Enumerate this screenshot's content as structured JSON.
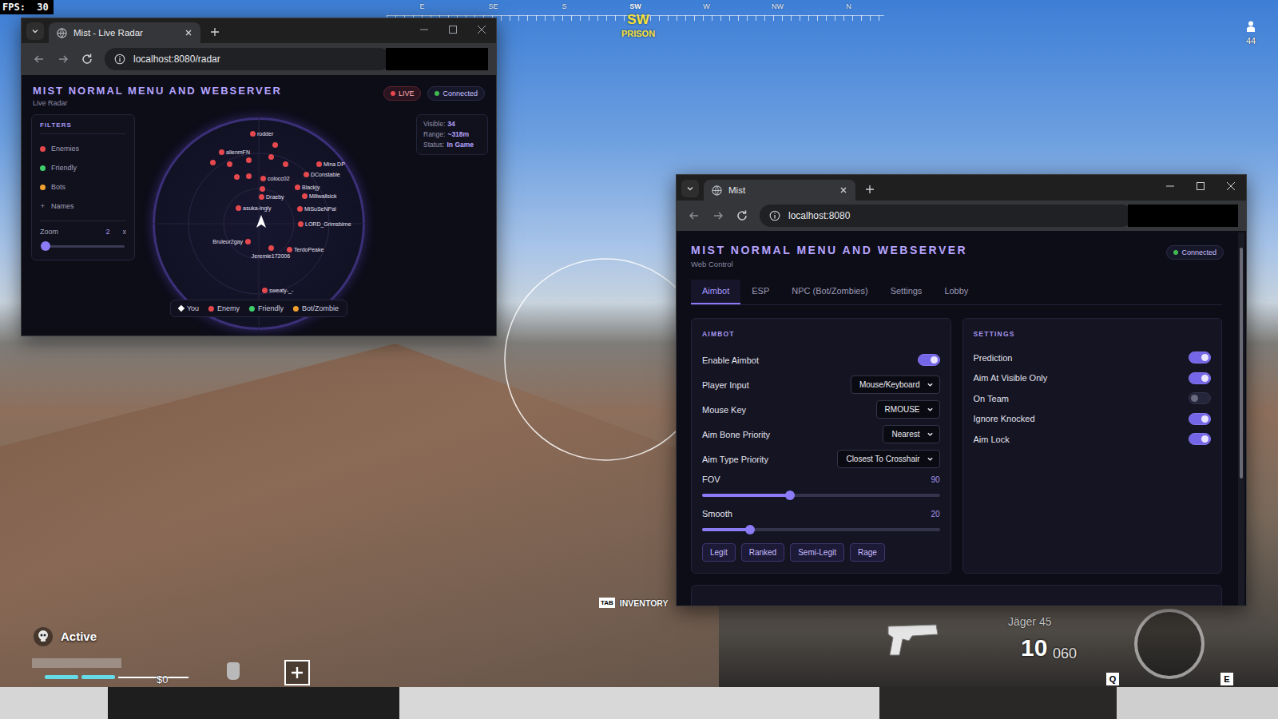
{
  "hud": {
    "fps": "FPS:  30",
    "compass": [
      {
        "label": "E",
        "selected": false
      },
      {
        "label": "SE",
        "selected": false
      },
      {
        "label": "S",
        "selected": false
      },
      {
        "label": "SW",
        "selected": true
      },
      {
        "label": "W",
        "selected": false
      },
      {
        "label": "NW",
        "selected": false
      },
      {
        "label": "N",
        "selected": false
      }
    ],
    "heading": "SW",
    "location": "PRISON",
    "players_left": "44",
    "status": "Active",
    "cash": "$0",
    "inventory_key": "TAB",
    "inventory_label": "INVENTORY",
    "weapon": "Jäger 45",
    "ammo": "10",
    "reserve": "060",
    "keys": [
      "Q",
      "E"
    ]
  },
  "radar_window": {
    "tab": {
      "title": "Mist - Live Radar"
    },
    "address": "localhost:8080/radar",
    "header": {
      "title": "MIST NORMAL MENU AND WEBSERVER",
      "subtitle": "Live Radar"
    },
    "badges": [
      {
        "label": "LIVE",
        "color": "#e5484d"
      },
      {
        "label": "Connected",
        "color": "#3fb950"
      }
    ],
    "filters": {
      "title": "FILTERS",
      "items": [
        {
          "label": "Enemies",
          "kind": "dot",
          "color": "#e5484d"
        },
        {
          "label": "Friendly",
          "kind": "dot",
          "color": "#3fcf6a"
        },
        {
          "label": "Bots",
          "kind": "dot",
          "color": "#f0a030"
        },
        {
          "label": "Names",
          "kind": "glyph",
          "glyph": "+"
        }
      ],
      "zoom": {
        "label": "Zoom",
        "value": "2",
        "unit": "x",
        "level": 0.05
      }
    },
    "stats": [
      {
        "label": "Visible:",
        "value": "34"
      },
      {
        "label": "Range:",
        "value": "~318m"
      },
      {
        "label": "Status:",
        "value": "In Game"
      }
    ],
    "blips": [
      {
        "name": "rodder",
        "kind": "enemy"
      },
      {
        "name": "alienmFN",
        "kind": "enemy"
      },
      {
        "name": "Mina DP",
        "kind": "enemy"
      },
      {
        "name": "DConstable",
        "kind": "enemy"
      },
      {
        "name": "Blackjy",
        "kind": "enemy"
      },
      {
        "name": "colocc02",
        "kind": "enemy"
      },
      {
        "name": "Draeby",
        "kind": "enemy"
      },
      {
        "name": "Millwallsick",
        "kind": "enemy"
      },
      {
        "name": "MiSuSeNPal",
        "kind": "enemy"
      },
      {
        "name": "LORD_Grimsbirne",
        "kind": "enemy"
      },
      {
        "name": "asuka-ingly",
        "kind": "enemy"
      },
      {
        "name": "Bruleur2gay",
        "kind": "enemy"
      },
      {
        "name": "Jeremie172006",
        "kind": "enemy"
      },
      {
        "name": "TerdoPeake",
        "kind": "enemy"
      },
      {
        "name": "sweaty-_-",
        "kind": "enemy"
      },
      {
        "name": "",
        "kind": "enemy"
      },
      {
        "name": "",
        "kind": "enemy"
      },
      {
        "name": "",
        "kind": "enemy"
      },
      {
        "name": "",
        "kind": "enemy"
      },
      {
        "name": "",
        "kind": "enemy"
      },
      {
        "name": "",
        "kind": "enemy"
      },
      {
        "name": "",
        "kind": "enemy"
      },
      {
        "name": "",
        "kind": "enemy"
      },
      {
        "name": "",
        "kind": "enemy"
      }
    ],
    "legend": [
      {
        "label": "You",
        "kind": "you",
        "color": "#ffffff"
      },
      {
        "label": "Enemy",
        "kind": "dot",
        "color": "#e5484d"
      },
      {
        "label": "Friendly",
        "kind": "dot",
        "color": "#3fcf6a"
      },
      {
        "label": "Bot/Zombie",
        "kind": "dot",
        "color": "#f0a030"
      }
    ]
  },
  "menu_window": {
    "tab": {
      "title": "Mist"
    },
    "address": "localhost:8080",
    "header": {
      "title": "MIST NORMAL MENU AND WEBSERVER",
      "subtitle": "Web Control"
    },
    "badge": {
      "label": "Connected",
      "color": "#3fb950"
    },
    "tabs": [
      {
        "label": "Aimbot",
        "selected": true
      },
      {
        "label": "ESP",
        "selected": false
      },
      {
        "label": "NPC (Bot/Zombies)",
        "selected": false
      },
      {
        "label": "Settings",
        "selected": false
      },
      {
        "label": "Lobby",
        "selected": false
      }
    ],
    "aimbot": {
      "title": "AIMBOT",
      "rows": [
        {
          "kind": "toggle",
          "label": "Enable Aimbot",
          "on": true
        },
        {
          "kind": "select",
          "label": "Player Input",
          "value": "Mouse/Keyboard"
        },
        {
          "kind": "select",
          "label": "Mouse Key",
          "value": "RMOUSE"
        },
        {
          "kind": "select",
          "label": "Aim Bone Priority",
          "value": "Nearest"
        },
        {
          "kind": "select",
          "label": "Aim Type Priority",
          "value": "Closest To Crosshair"
        },
        {
          "kind": "slider",
          "label": "FOV",
          "value": "90",
          "level": 0.37
        },
        {
          "kind": "slider",
          "label": "Smooth",
          "value": "20",
          "level": 0.2
        }
      ],
      "presets": [
        "Legit",
        "Ranked",
        "Semi-Legit",
        "Rage"
      ]
    },
    "settings": {
      "title": "SETTINGS",
      "rows": [
        {
          "label": "Prediction",
          "on": true
        },
        {
          "label": "Aim At Visible Only",
          "on": true
        },
        {
          "label": "On Team",
          "on": false
        },
        {
          "label": "Ignore Knocked",
          "on": true
        },
        {
          "label": "Aim Lock",
          "on": true
        }
      ]
    }
  }
}
